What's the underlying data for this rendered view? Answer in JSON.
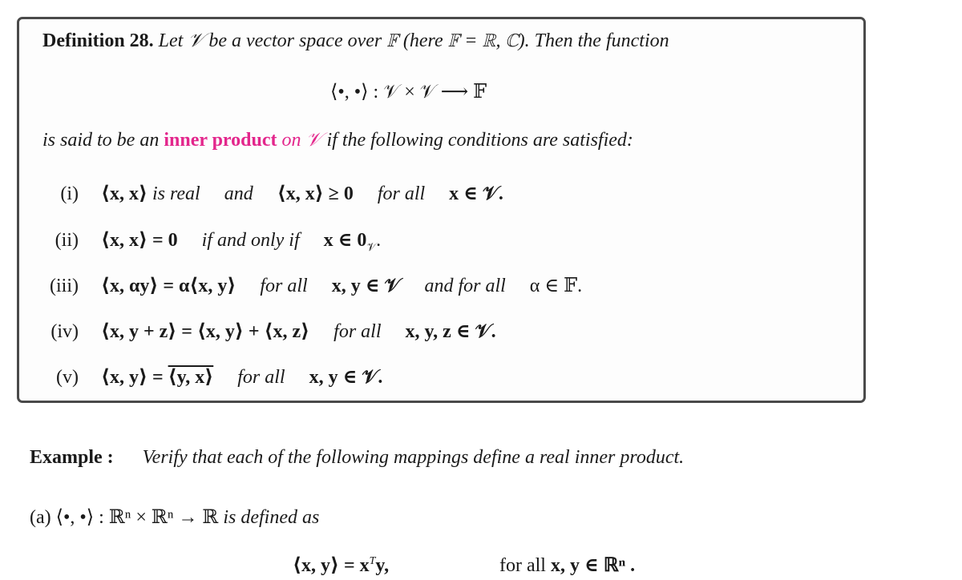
{
  "definition": {
    "heading": "Definition 28.",
    "intro": "Let 𝒱 be a vector space over 𝔽 (here 𝔽 = ℝ, ℂ). Then the function",
    "display_equation": "⟨•, •⟩ : 𝒱 × 𝒱 ⟶ 𝔽",
    "statement_pre": "is said to be an",
    "term": "inner product",
    "term_on": "on 𝒱",
    "statement_post": "if the following conditions are satisfied:",
    "term_color": "#e3268c",
    "conditions": [
      {
        "label": "(i)",
        "expr": "⟨x, x⟩",
        "text1": "is real",
        "and": "and",
        "expr2": "⟨x, x⟩ ≥ 0",
        "quant": "for all",
        "domain": "x ∈ 𝒱."
      },
      {
        "label": "(ii)",
        "expr": "⟨x, x⟩ = 0",
        "quant": "if and only if",
        "domain": "x ∈ 0",
        "subscript": "𝒱",
        "end": "."
      },
      {
        "label": "(iii)",
        "expr": "⟨x, αy⟩ = α⟨x, y⟩",
        "quant": "for all",
        "domain": "x, y ∈ 𝒱",
        "quant2": "and for all",
        "domain2": "α ∈ 𝔽."
      },
      {
        "label": "(iv)",
        "expr": "⟨x, y + z⟩ = ⟨x, y⟩ + ⟨x, z⟩",
        "quant": "for all",
        "domain": "x, y, z ∈ 𝒱."
      },
      {
        "label": "(v)",
        "expr_lhs": "⟨x, y⟩ =",
        "expr_rhs": "⟨y, x⟩",
        "quant": "for all",
        "domain": "x, y ∈ 𝒱."
      }
    ]
  },
  "example": {
    "heading": "Example :",
    "prompt": "Verify that each of the following mappings define a real inner product.",
    "part_a": {
      "label": "(a)",
      "mapping": "⟨•, •⟩ : ℝⁿ × ℝⁿ → ℝ",
      "text": "is defined as",
      "formula_lhs": "⟨x, y⟩ = x",
      "formula_sup": "T",
      "formula_rhs": "y,",
      "quant": "for all",
      "domain": "x, y ∈ ℝⁿ ."
    }
  }
}
